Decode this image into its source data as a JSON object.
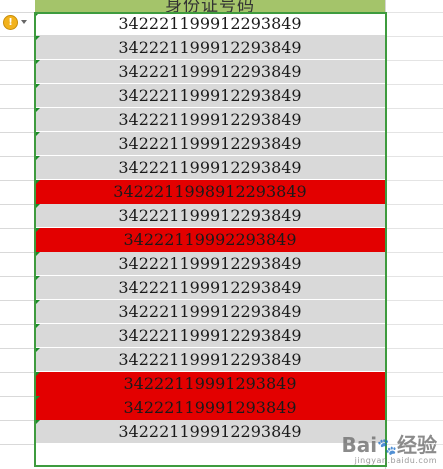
{
  "header": {
    "column_title": "身份证号码"
  },
  "warning": {
    "icon": "warning-icon",
    "glyph": "!",
    "color": "#f2b21c"
  },
  "colors": {
    "highlight_red": "#e30000",
    "cell_gray": "#d9d9d9",
    "header_green": "#a4c46a",
    "selection_green": "#3e9b3e"
  },
  "rows": [
    {
      "value": "342221199912293849",
      "fill": "white"
    },
    {
      "value": "342221199912293849",
      "fill": "gray"
    },
    {
      "value": "342221199912293849",
      "fill": "gray"
    },
    {
      "value": "342221199912293849",
      "fill": "gray"
    },
    {
      "value": "342221199912293849",
      "fill": "gray"
    },
    {
      "value": "342221199912293849",
      "fill": "gray"
    },
    {
      "value": "342221199912293849",
      "fill": "gray"
    },
    {
      "value": "3422211998912293849",
      "fill": "red"
    },
    {
      "value": "342221199912293849",
      "fill": "gray"
    },
    {
      "value": "34222119992293849",
      "fill": "red"
    },
    {
      "value": "342221199912293849",
      "fill": "gray"
    },
    {
      "value": "342221199912293849",
      "fill": "gray"
    },
    {
      "value": "342221199912293849",
      "fill": "gray"
    },
    {
      "value": "342221199912293849",
      "fill": "gray"
    },
    {
      "value": "342221199912293849",
      "fill": "gray"
    },
    {
      "value": "34222119991293849",
      "fill": "red"
    },
    {
      "value": "34222119991293849",
      "fill": "red"
    },
    {
      "value": "342221199912293849",
      "fill": "gray"
    }
  ],
  "watermark": {
    "logo_text": "Bai",
    "logo_suffix": "经验",
    "sub": "jingyan.baidu.com"
  }
}
